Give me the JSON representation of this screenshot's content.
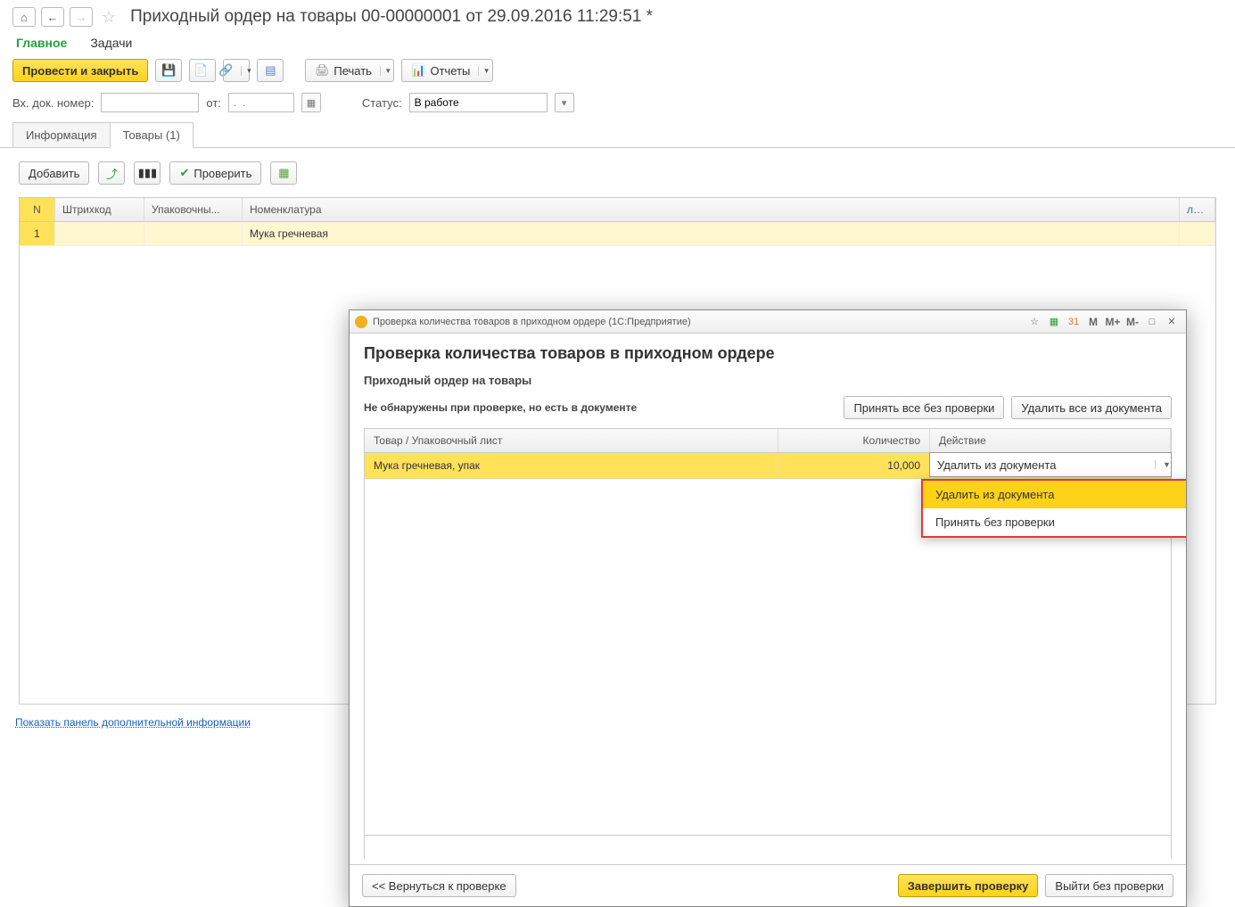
{
  "header": {
    "title": "Приходный ордер на товары 00-00000001 от 29.09.2016 11:29:51 *"
  },
  "nav": {
    "main": "Главное",
    "tasks": "Задачи"
  },
  "toolbar": {
    "post_and_close": "Провести и закрыть",
    "print": "Печать",
    "reports": "Отчеты"
  },
  "filters": {
    "doc_label": "Вх. док. номер:",
    "from_label": "от:",
    "date_placeholder": ".  .",
    "status_label": "Статус:",
    "status_value": "В работе"
  },
  "doc_tabs": {
    "info": "Информация",
    "goods": "Товары (1)"
  },
  "inner": {
    "add": "Добавить",
    "check": "Проверить"
  },
  "grid": {
    "cols": {
      "n": "N",
      "barcode": "Штрихкод",
      "pack": "Упаковочны...",
      "nom": "Номенклатура",
      "right": "ло..."
    },
    "row": {
      "n": "1",
      "barcode": "",
      "pack": "",
      "nom": "Мука гречневая"
    }
  },
  "footer_link": "Показать панель дополнительной информации",
  "modal": {
    "win_title": "Проверка количества товаров в приходном ордере  (1С:Предприятие)",
    "heading": "Проверка количества товаров в приходном ордере",
    "sub": "Приходный ордер на товары",
    "warn": "Не обнаружены при проверке, но есть в документе",
    "accept_all": "Принять все без проверки",
    "delete_all": "Удалить все из документа",
    "cols": {
      "item": "Товар / Упаковочный лист",
      "qty": "Количество",
      "action": "Действие"
    },
    "row": {
      "item": "Мука гречневая, упак",
      "qty": "10,000",
      "action": "Удалить из документа"
    },
    "dd": {
      "opt1": "Удалить из документа",
      "opt2": "Принять без проверки"
    },
    "back": "<<  Вернуться к проверке",
    "finish": "Завершить проверку",
    "exit": "Выйти без проверки",
    "tb": {
      "m": "M",
      "mp": "M+",
      "mm": "M-"
    }
  }
}
